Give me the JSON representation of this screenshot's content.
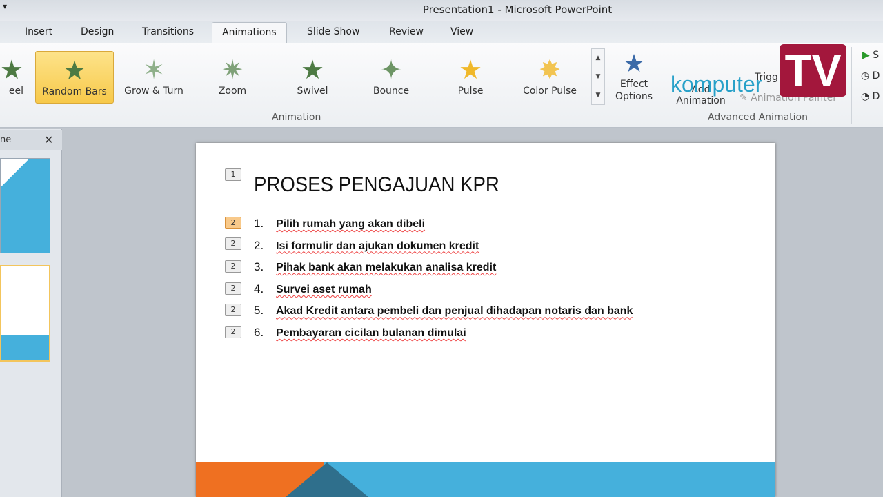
{
  "window": {
    "title": "Presentation1  -  Microsoft PowerPoint"
  },
  "tabs": [
    "Insert",
    "Design",
    "Transitions",
    "Animations",
    "Slide Show",
    "Review",
    "View"
  ],
  "active_tab": "Animations",
  "ribbon": {
    "effects": [
      {
        "label": "eel",
        "icon": "star-icon"
      },
      {
        "label": "Random Bars",
        "icon": "star-icon",
        "selected": true
      },
      {
        "label": "Grow & Turn",
        "icon": "star-icon"
      },
      {
        "label": "Zoom",
        "icon": "star-icon"
      },
      {
        "label": "Swivel",
        "icon": "star-icon"
      },
      {
        "label": "Bounce",
        "icon": "star-icon"
      },
      {
        "label": "Pulse",
        "icon": "star-icon"
      },
      {
        "label": "Color Pulse",
        "icon": "star-icon"
      }
    ],
    "effect_options": "Effect Options",
    "animation_group": "Animation",
    "add_animation": "Add Animation",
    "trigger": "Trigg",
    "animation_painter": "Animation Painter",
    "advanced_group": "Advanced Animation",
    "timing": [
      "S",
      "D",
      "D"
    ]
  },
  "watermark": {
    "brand": "komputer",
    "tv": "TV"
  },
  "pane": {
    "header": "ne"
  },
  "slide": {
    "title": "PROSES PENGAJUAN KPR",
    "title_tag": "1",
    "items": [
      {
        "num": "1.",
        "text": "Pilih rumah yang akan dibeli",
        "tag": "2"
      },
      {
        "num": "2.",
        "text": "Isi formulir dan ajukan dokumen kredit",
        "tag": "2"
      },
      {
        "num": "3.",
        "text": "Pihak bank akan melakukan analisa kredit",
        "tag": "2"
      },
      {
        "num": "4.",
        "text": "Survei aset rumah",
        "tag": "2"
      },
      {
        "num": "5.",
        "text": "Akad Kredit antara pembeli dan penjual dihadapan notaris dan bank",
        "tag": "2"
      },
      {
        "num": "6.",
        "text": "Pembayaran cicilan bulanan dimulai",
        "tag": "2"
      }
    ]
  },
  "colors": {
    "accent_orange": "#ef7021",
    "accent_blue": "#45b0dc",
    "selected": "#f7c94a"
  }
}
